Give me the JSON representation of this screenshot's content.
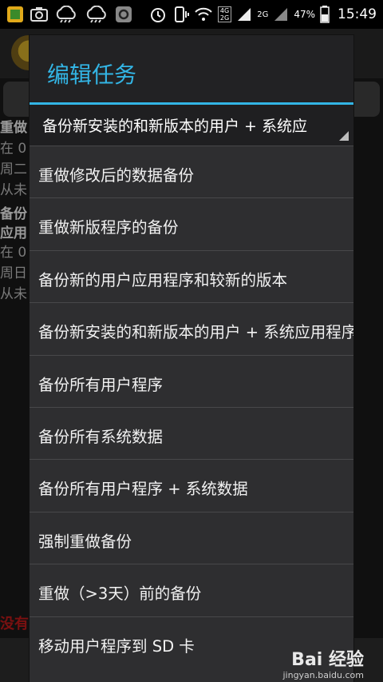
{
  "status_bar": {
    "time": "15:49",
    "battery_percent": "47%",
    "network_a": "4G",
    "network_b": "2G",
    "network_c": "2G",
    "icons": [
      "app-icon",
      "screenshot-icon",
      "cloud-icon",
      "cloud-icon",
      "settings-icon",
      "alarm-icon",
      "vibrate-icon",
      "wifi-icon",
      "signal-icon",
      "battery-icon"
    ]
  },
  "background": {
    "lines": [
      {
        "text": "重做",
        "bold": true
      },
      {
        "text": "在 0",
        "bold": false
      },
      {
        "text": "周二",
        "bold": false
      },
      {
        "text": "从未",
        "bold": false
      },
      {
        "text": "备份",
        "bold": true
      },
      {
        "text": "应用",
        "bold": true
      },
      {
        "text": "在 0",
        "bold": false
      },
      {
        "text": "周日",
        "bold": false
      },
      {
        "text": "从未",
        "bold": false
      }
    ],
    "red_text": "没有"
  },
  "dialog": {
    "title": "编辑任务",
    "selected_value": "备份新安装的和新版本的用户 + 系统应",
    "options": [
      "重做修改后的数据备份",
      "重做新版程序的备份",
      "备份新的用户应用程序和较新的版本",
      "备份新安装的和新版本的用户 + 系统应用程序",
      "备份所有用户程序",
      "备份所有系统数据",
      "备份所有用户程序 + 系统数据",
      "强制重做备份",
      "重做（>3天）前的备份",
      "移动用户程序到 SD 卡"
    ]
  },
  "watermark": {
    "main": "Bai 经验",
    "sub": "jingyan.baidu.com"
  },
  "colors": {
    "accent": "#33b5e5"
  }
}
